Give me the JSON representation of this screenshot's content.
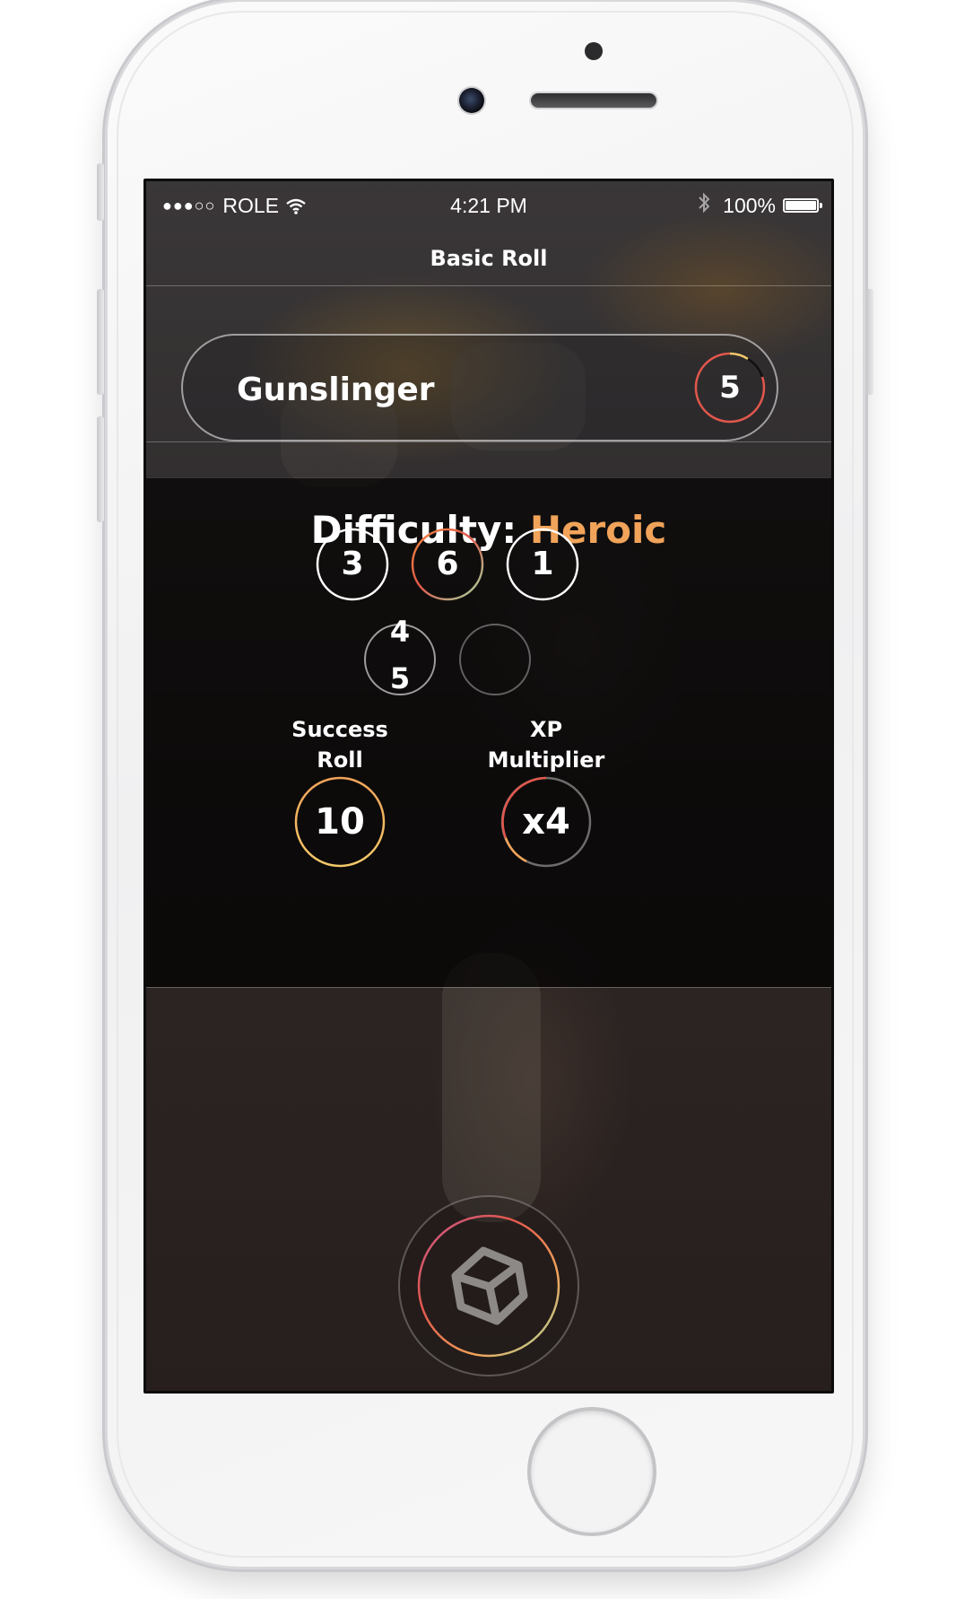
{
  "status_bar": {
    "signal": "●●●○○",
    "carrier": "ROLE",
    "time": "4:21 PM",
    "battery": "100%"
  },
  "nav": {
    "title": "Basic Roll"
  },
  "class_selector": {
    "name": "Gunslinger",
    "level": "5"
  },
  "difficulty": {
    "label": "Difficulty:",
    "value": "Heroic",
    "value_color": "#f1a35a"
  },
  "dice": [
    {
      "value": "3",
      "style": "white"
    },
    {
      "value": "6",
      "style": "gradient"
    },
    {
      "value": "1",
      "style": "white"
    },
    {
      "value_top": "4",
      "value_bottom": "5",
      "style": "white"
    },
    {
      "value": "",
      "style": "dim"
    }
  ],
  "stats": {
    "success": {
      "label_line1": "Success",
      "label_line2": "Roll",
      "value": "10"
    },
    "xp": {
      "label_line1": "XP",
      "label_line2": "Multiplier",
      "value": "x4"
    }
  },
  "roll_button": {
    "icon": "cube-icon"
  },
  "colors": {
    "accent_orange": "#f1a35a",
    "ring_red": "#e2574c",
    "ring_yellow": "#f4c96a",
    "ring_green": "#9fd9a0"
  }
}
